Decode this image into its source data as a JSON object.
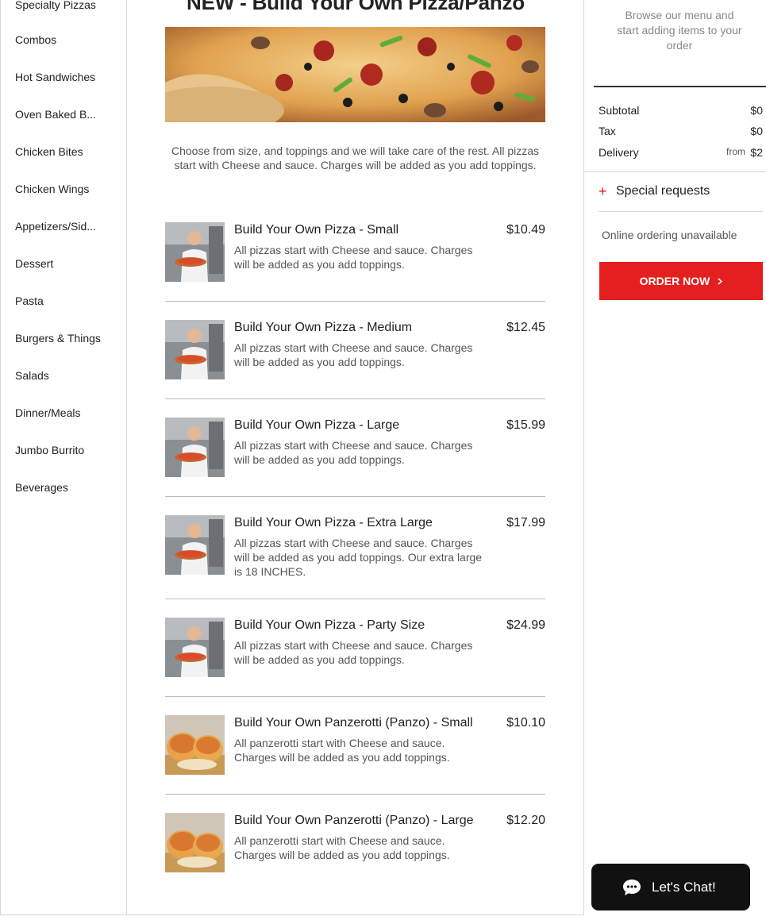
{
  "sidebar": {
    "categories": [
      "Specialty Pizzas",
      "Combos",
      "Hot Sandwiches",
      "Oven Baked B...",
      "Chicken Bites",
      "Chicken Wings",
      "Appetizers/Sid...",
      "Dessert",
      "Pasta",
      "Burgers & Things",
      "Salads",
      "Dinner/Meals",
      "Jumbo Burrito",
      "Beverages"
    ]
  },
  "section": {
    "title": "NEW - Build Your Own Pizza/Panzo",
    "description": "Choose from size, and toppings and we will take care of the rest. All pizzas start with Cheese and sauce. Charges will be added as you add toppings."
  },
  "items": [
    {
      "name": "Build Your Own Pizza - Small",
      "price": "$10.49",
      "desc": "All pizzas start with Cheese and sauce. Charges will be added as you add toppings.",
      "thumb": "chef-pizza"
    },
    {
      "name": "Build Your Own Pizza - Medium",
      "price": "$12.45",
      "desc": "All pizzas start with Cheese and sauce. Charges will be added as you add toppings.",
      "thumb": "chef-pizza"
    },
    {
      "name": "Build Your Own Pizza - Large",
      "price": "$15.99",
      "desc": "All pizzas start with Cheese and sauce. Charges will be added as you add toppings.",
      "thumb": "chef-pizza"
    },
    {
      "name": "Build Your Own Pizza - Extra Large",
      "price": "$17.99",
      "desc": "All pizzas start with Cheese and sauce. Charges will be added as you add toppings. Our extra large is 18 INCHES.",
      "thumb": "chef-pizza"
    },
    {
      "name": "Build Your Own Pizza - Party Size",
      "price": "$24.99",
      "desc": "All pizzas start with Cheese and sauce. Charges will be added as you add toppings.",
      "thumb": "chef-pizza"
    },
    {
      "name": "Build Your Own Panzerotti (Panzo) - Small",
      "price": "$10.10",
      "desc": "All panzerotti start with Cheese and sauce. Charges will be added as you add toppings.",
      "thumb": "panzerotti"
    },
    {
      "name": "Build Your Own Panzerotti (Panzo) - Large",
      "price": "$12.20",
      "desc": "All panzerotti start with Cheese and sauce. Charges will be added as you add toppings.",
      "thumb": "panzerotti"
    }
  ],
  "cart": {
    "empty_message": "Browse our menu and start adding items to your order",
    "subtotal_label": "Subtotal",
    "subtotal_value": "$0",
    "tax_label": "Tax",
    "tax_value": "$0",
    "delivery_label": "Delivery",
    "delivery_from": "from",
    "delivery_value": "$2",
    "special_requests": "Special requests",
    "unavailable": "Online ordering unavailable",
    "order_button": "ORDER NOW"
  },
  "chat": {
    "label": "Let's Chat!",
    "icon": "chat-bubble-icon"
  },
  "colors": {
    "accent": "#e51f1f",
    "chat_bg": "#111111"
  }
}
